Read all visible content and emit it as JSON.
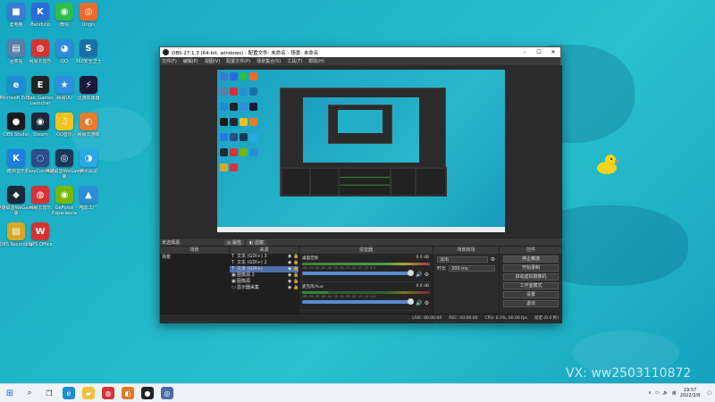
{
  "desktop_icons": [
    {
      "label": "此电脑",
      "color": "#3a7bd5",
      "glyph": "■"
    },
    {
      "label": "BandizIp",
      "color": "#2b6cd8",
      "glyph": "K"
    },
    {
      "label": "微信",
      "color": "#2dbd52",
      "glyph": "◉"
    },
    {
      "label": "Origin",
      "color": "#f06b2b",
      "glyph": "◎"
    },
    {
      "label": "回收站",
      "color": "#5a7fa8",
      "glyph": "▤"
    },
    {
      "label": "网易云音乐",
      "color": "#d63434",
      "glyph": "◍"
    },
    {
      "label": "QQ",
      "color": "#2b8cd8",
      "glyph": "◕"
    },
    {
      "label": "360安全卫士",
      "color": "#1b6fa8",
      "glyph": "S"
    },
    {
      "label": "Microsoft Edge",
      "color": "#1c8ed1",
      "glyph": "e"
    },
    {
      "label": "Epic Games Launcher",
      "color": "#222222",
      "glyph": "E"
    },
    {
      "label": "网易UU",
      "color": "#2f8fe0",
      "glyph": "★"
    },
    {
      "label": "迅游加速器",
      "color": "#1a1a3a",
      "glyph": "⚡"
    },
    {
      "label": "OBS Studio",
      "color": "#1a1a1a",
      "glyph": "●"
    },
    {
      "label": "Steam",
      "color": "#1b2838",
      "glyph": "◉"
    },
    {
      "label": "QQ音乐",
      "color": "#f5c21b",
      "glyph": "♫"
    },
    {
      "label": "网易云游戏",
      "color": "#e87a2b",
      "glyph": "◐"
    },
    {
      "label": "酷狗音乐",
      "color": "#1e7ee0",
      "glyph": "K"
    },
    {
      "label": "EasyConnect",
      "color": "#2b4d8a",
      "glyph": "◌"
    },
    {
      "label": "英雄联盟WeGame版",
      "color": "#1a3a5a",
      "glyph": "◎"
    },
    {
      "label": "腾讯会议",
      "color": "#2aa8e8",
      "glyph": "◑"
    },
    {
      "label": "英雄联盟WeGame版",
      "color": "#1a2a3a",
      "glyph": "◆"
    },
    {
      "label": "网易云音乐",
      "color": "#d63434",
      "glyph": "◍"
    },
    {
      "label": "GeForce Experience",
      "color": "#76b900",
      "glyph": "◉"
    },
    {
      "label": "喵影工厂",
      "color": "#2b8cd8",
      "glyph": "▲"
    },
    {
      "label": "OBS Recording",
      "color": "#d8a92b",
      "glyph": "▤"
    },
    {
      "label": "WPS Office",
      "color": "#d63434",
      "glyph": "W"
    }
  ],
  "obs": {
    "title": "OBS 27.1.3 (64-bit, windows) - 配置文件: 未命名 - 场景: 未命名",
    "menu": [
      "文件(F)",
      "编辑(E)",
      "视图(V)",
      "配置文件(P)",
      "场景集合(S)",
      "工具(T)",
      "帮助(H)"
    ],
    "dock_row": {
      "label": "未选择源",
      "props_btn": "◎ 属性",
      "filters_btn": "◐ 滤镜"
    },
    "scenes": {
      "title": "场景",
      "items": [
        "场景"
      ]
    },
    "sources": {
      "title": "来源",
      "items": [
        {
          "name": "文本 (GDI+) 3",
          "icon": "T",
          "selected": false
        },
        {
          "name": "文本 (GDI+) 2",
          "icon": "T",
          "selected": false
        },
        {
          "name": "文本 (GDI+)",
          "icon": "T",
          "selected": true
        },
        {
          "name": "图像源 2",
          "icon": "▣",
          "selected": false
        },
        {
          "name": "图像源",
          "icon": "▣",
          "selected": false
        },
        {
          "name": "显示器采集",
          "icon": "▭",
          "selected": false
        }
      ]
    },
    "mixer": {
      "title": "混音器",
      "tracks": [
        {
          "name": "桌面音频",
          "db": "0.0 dB"
        },
        {
          "name": "麦克风/Aux",
          "db": "0.0 dB"
        }
      ],
      "scale": "-60 -55 -50 -45 -40 -35 -30 -25 -20 -15 -10 -5 0"
    },
    "transitions": {
      "title": "场景转场",
      "selected": "淡出",
      "duration_label": "时长",
      "duration": "300 ms"
    },
    "controls": {
      "title": "控件",
      "buttons": [
        "停止推流",
        "开始录制",
        "启动虚拟摄像机",
        "工作室模式",
        "设置",
        "退出"
      ]
    },
    "status": {
      "live": "LIVE: 00:00:00",
      "rec": "REC: 00:00:00",
      "cpu": "CPU: 0.3%, 60.00 fps",
      "stream": "延迟 (0.0 秒)"
    }
  },
  "taskbar": {
    "time": "19:57",
    "date": "2022/3/8",
    "ime": "英"
  },
  "watermark": "VX: ww2503110872"
}
